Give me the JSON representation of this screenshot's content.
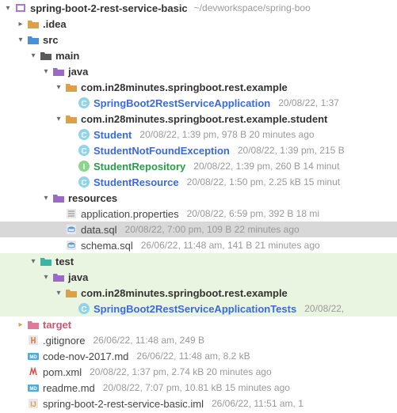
{
  "root": {
    "name": "spring-boot-2-rest-service-basic",
    "path": "~/devworkspace/spring-boo"
  },
  "idea": {
    "name": ".idea"
  },
  "src": {
    "name": "src"
  },
  "main": {
    "name": "main"
  },
  "java_main": {
    "name": "java"
  },
  "pkg_example": {
    "name": "com.in28minutes.springboot.rest.example"
  },
  "app_class": {
    "name": "SpringBoot2RestServiceApplication",
    "meta": "20/08/22, 1:37"
  },
  "pkg_student": {
    "name": "com.in28minutes.springboot.rest.example.student"
  },
  "student": {
    "name": "Student",
    "meta": "20/08/22, 1:39 pm, 978 B 20 minutes ago"
  },
  "student_nf": {
    "name": "StudentNotFoundException",
    "meta": "20/08/22, 1:39 pm, 215 B"
  },
  "student_repo": {
    "name": "StudentRepository",
    "meta": "20/08/22, 1:39 pm, 260 B 14 minut"
  },
  "student_res": {
    "name": "StudentResource",
    "meta": "20/08/22, 1:50 pm, 2.25 kB 15 minut"
  },
  "resources": {
    "name": "resources"
  },
  "app_props": {
    "name": "application.properties",
    "meta": "20/08/22, 6:59 pm, 392 B 18 mi"
  },
  "data_sql": {
    "name": "data.sql",
    "meta": "20/08/22, 7:00 pm, 109 B 22 minutes ago"
  },
  "schema_sql": {
    "name": "schema.sql",
    "meta": "26/06/22, 11:48 am, 141 B 21 minutes ago"
  },
  "test": {
    "name": "test"
  },
  "java_test": {
    "name": "java"
  },
  "pkg_test": {
    "name": "com.in28minutes.springboot.rest.example"
  },
  "test_class": {
    "name": "SpringBoot2RestServiceApplicationTests",
    "meta": "20/08/22,"
  },
  "target": {
    "name": "target"
  },
  "gitignore": {
    "name": ".gitignore",
    "meta": "26/06/22, 11:48 am, 249 B"
  },
  "code_nov": {
    "name": "code-nov-2017.md",
    "meta": "26/06/22, 11:48 am, 8.2 kB"
  },
  "pom": {
    "name": "pom.xml",
    "meta": "20/08/22, 1:37 pm, 2.74 kB 20 minutes ago"
  },
  "readme": {
    "name": "readme.md",
    "meta": "20/08/22, 7:07 pm, 10.81 kB 15 minutes ago"
  },
  "iml": {
    "name": "spring-boot-2-rest-service-basic.iml",
    "meta": "26/06/22, 11:51 am, 1"
  }
}
